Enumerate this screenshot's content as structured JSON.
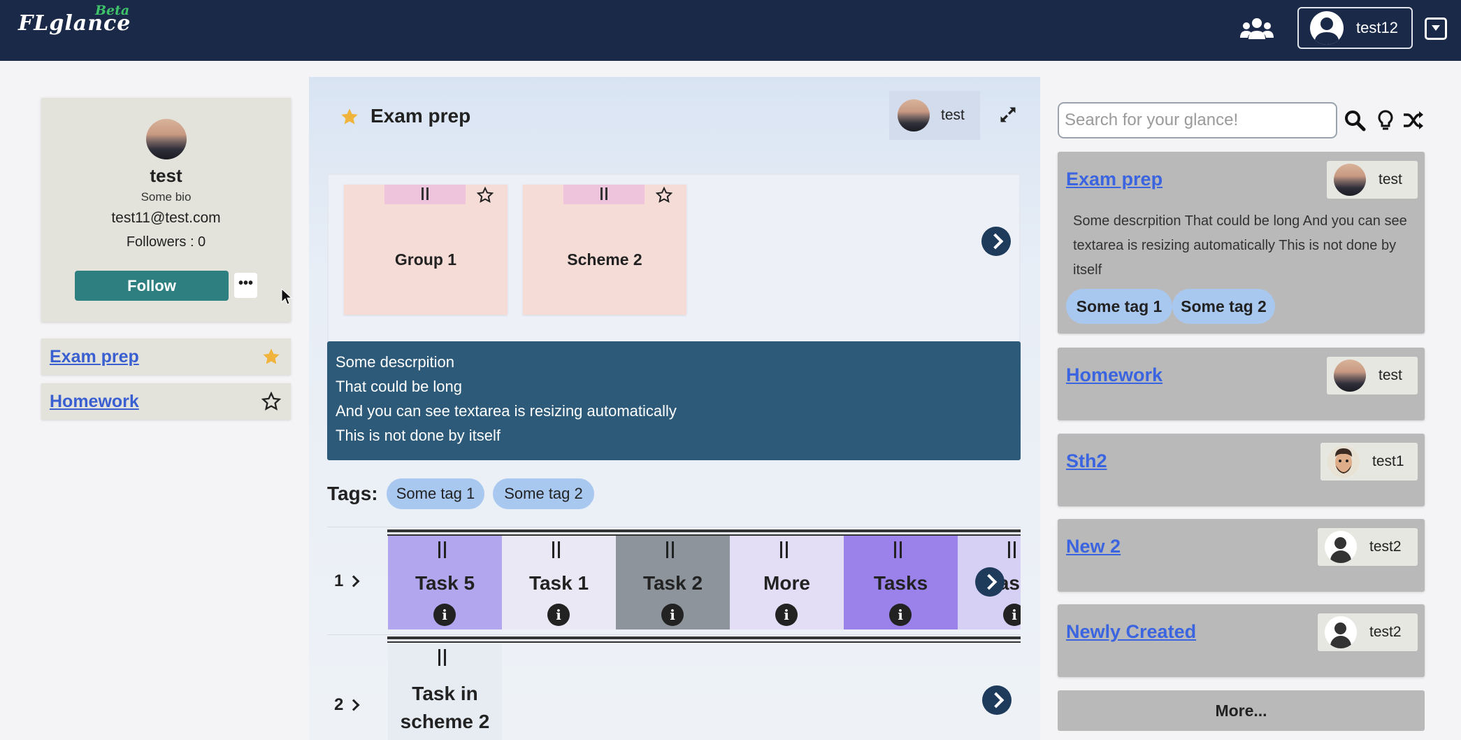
{
  "navbar": {
    "logo": "FLglance",
    "beta": "Beta",
    "username": "test12"
  },
  "profile": {
    "name": "test",
    "bio": "Some bio",
    "email": "test11@test.com",
    "followers": "Followers : 0",
    "follow_label": "Follow",
    "more_label": "•••"
  },
  "sidebar": {
    "items": [
      {
        "label": "Exam prep",
        "starred": true
      },
      {
        "label": "Homework",
        "starred": false
      }
    ]
  },
  "glance": {
    "title": "Exam prep",
    "owner": "test",
    "groups": [
      {
        "label": "Group 1"
      },
      {
        "label": "Scheme 2"
      }
    ],
    "description_lines": [
      "Some descrpition",
      "That could be long",
      "And you can see textarea is resizing automatically",
      "This is not done by itself"
    ],
    "tags_label": "Tags:",
    "tags": [
      "Some tag 1",
      "Some tag 2"
    ],
    "rows": [
      {
        "number": "1",
        "tasks": [
          {
            "label": "Task 5",
            "color": "#b2a6ef"
          },
          {
            "label": "Task 1",
            "color": "#ebe8f6"
          },
          {
            "label": "Task 2",
            "color": "#8d949c"
          },
          {
            "label": "More",
            "color": "#e3def5"
          },
          {
            "label": "Tasks",
            "color": "#9a82ea"
          },
          {
            "label": "Tasks",
            "color": "#d6d0f4"
          }
        ]
      },
      {
        "number": "2",
        "tasks": [
          {
            "label": "Task in scheme 2",
            "color": "#e7ecf3"
          }
        ]
      }
    ]
  },
  "search": {
    "placeholder": "Search for your glance!"
  },
  "results": [
    {
      "title": "Exam prep",
      "owner": "test",
      "avatar": "photo",
      "description": "Some descrpition That could be long And you can see textarea is resizing automatically This is not done by itself",
      "tags": [
        "Some tag 1",
        "Some tag 2"
      ]
    },
    {
      "title": "Homework",
      "owner": "test",
      "avatar": "photo"
    },
    {
      "title": "Sth2",
      "owner": "test1",
      "avatar": "memoji"
    },
    {
      "title": "New 2",
      "owner": "test2",
      "avatar": "placeholder"
    },
    {
      "title": "Newly Created",
      "owner": "test2",
      "avatar": "placeholder"
    }
  ],
  "more_label": "More...",
  "colors": {
    "navbar": "#1a2947",
    "follow": "#2e7f7f",
    "description_bg": "#2c5a78",
    "tag": "#a9c8f0",
    "link": "#3a64e0",
    "star": "#f0b43c"
  }
}
